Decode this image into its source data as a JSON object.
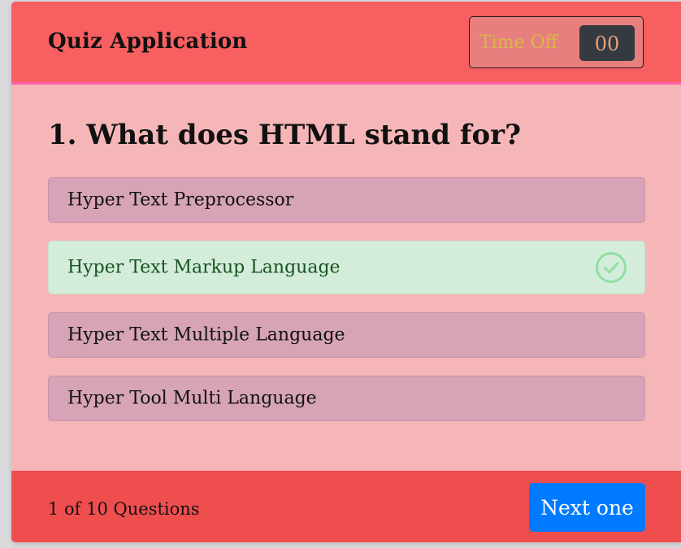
{
  "header": {
    "title": "Quiz Application",
    "timer_label": "Time Off",
    "timer_value": "00"
  },
  "question": {
    "text": "1. What does HTML stand for?"
  },
  "options": [
    {
      "label": "Hyper Text Preprocessor",
      "state": "default"
    },
    {
      "label": "Hyper Text Markup Language",
      "state": "correct"
    },
    {
      "label": "Hyper Text Multiple Language",
      "state": "default"
    },
    {
      "label": "Hyper Tool Multi Language",
      "state": "default"
    }
  ],
  "footer": {
    "progress": "1 of 10 Questions",
    "next_label": "Next one"
  },
  "icons": {
    "correct": "check-circle-icon"
  },
  "colors": {
    "header_bg": "#f85f60",
    "body_bg": "#f6b6b7",
    "footer_bg": "#ef4e4f",
    "option_bg": "#d6a4b6",
    "correct_bg": "#d4eddb",
    "correct_icon": "#8ee0a0",
    "button_bg": "#007bff"
  }
}
